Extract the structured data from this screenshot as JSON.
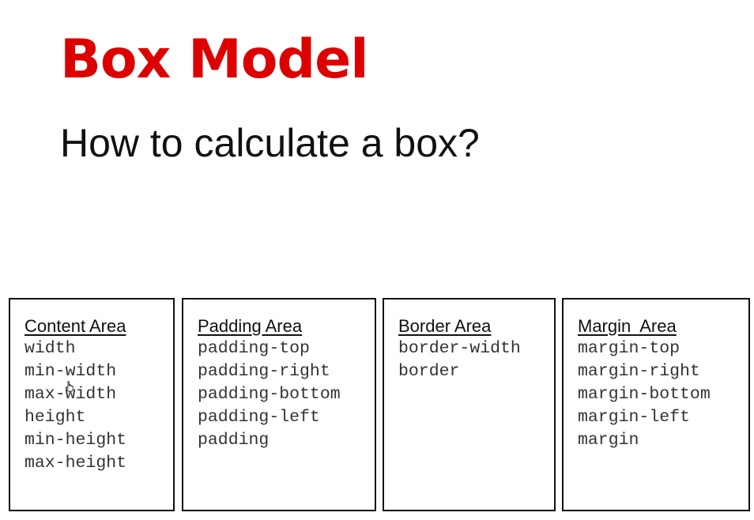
{
  "title": "Box Model",
  "subtitle": "How to calculate a box?",
  "colors": {
    "title": "#dd0000",
    "text": "#111111",
    "border": "#111111"
  },
  "boxes": [
    {
      "heading": "Content Area",
      "items": [
        "width",
        "min-width",
        "max-width",
        "height",
        "min-height",
        "max-height"
      ]
    },
    {
      "heading": "Padding Area",
      "items": [
        "padding-top",
        "padding-right",
        "padding-bottom",
        "padding-left",
        "padding"
      ]
    },
    {
      "heading": "Border Area",
      "items": [
        "border-width",
        "border"
      ]
    },
    {
      "heading": "Margin  Area",
      "items": [
        "margin-top",
        "margin-right",
        "margin-bottom",
        "margin-left",
        "margin"
      ]
    }
  ],
  "cursor_icon": "hand-pointer-icon"
}
